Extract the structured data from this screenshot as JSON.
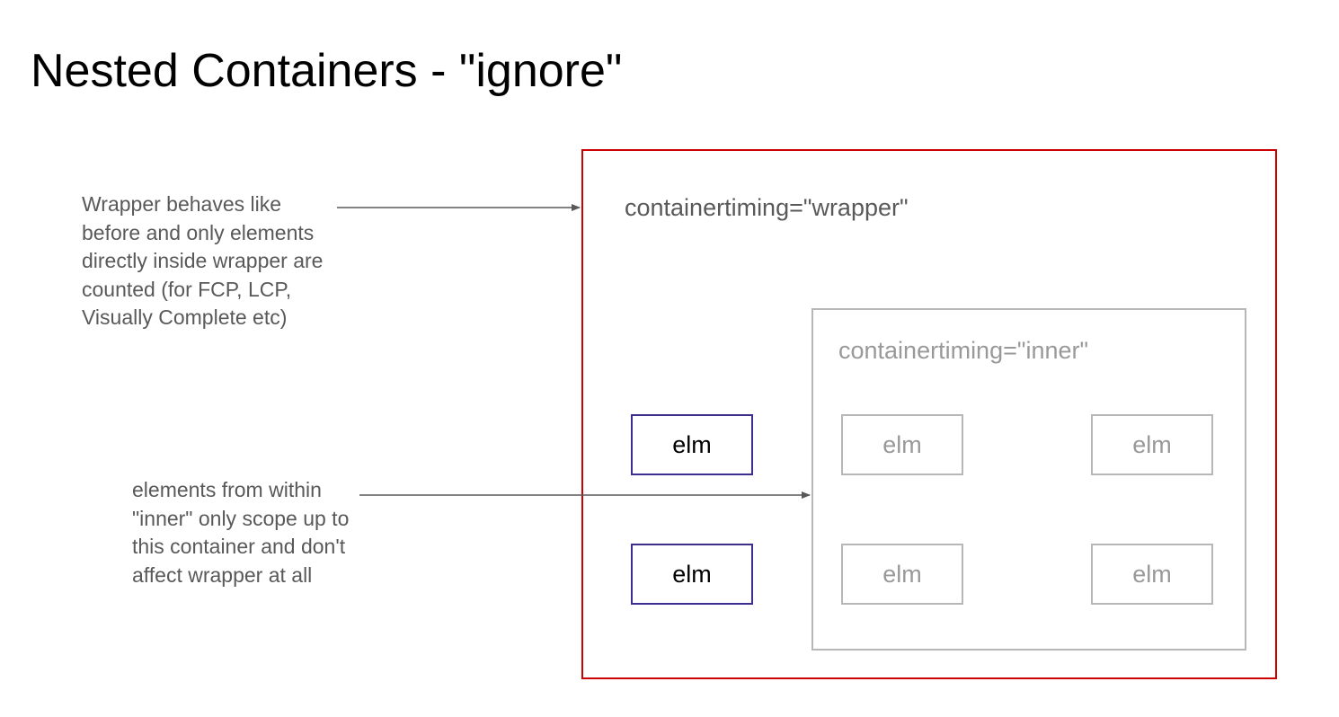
{
  "title": "Nested Containers - \"ignore\"",
  "notes": {
    "wrapper": [
      "Wrapper behaves like",
      "before and only elements",
      "directly inside wrapper are",
      "counted (for FCP, LCP,",
      "Visually Complete etc)"
    ],
    "inner": [
      "elements from within",
      "\"inner\" only scope up to",
      "this container and don't",
      "affect wrapper at all"
    ]
  },
  "containers": {
    "wrapper_label": "containertiming=\"wrapper\"",
    "inner_label": "containertiming=\"inner\""
  },
  "elements": {
    "direct": [
      "elm",
      "elm"
    ],
    "nested": [
      "elm",
      "elm",
      "elm",
      "elm"
    ]
  },
  "colors": {
    "wrapper_border": "#cc0000",
    "inner_border": "#b7b7b7",
    "direct_element_border": "#3d2f8f",
    "note_text": "#595959",
    "nested_text": "#999999",
    "arrow": "#595959"
  }
}
